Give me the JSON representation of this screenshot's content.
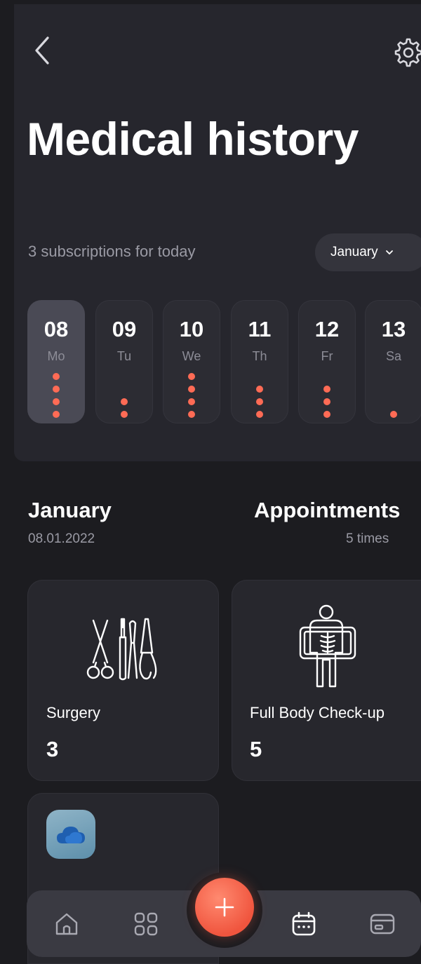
{
  "header": {
    "title": "Medical history",
    "subscriptions_text": "3 subscriptions for today",
    "month_select": "January"
  },
  "days": [
    {
      "num": "08",
      "name": "Mo",
      "appointments": 4,
      "selected": true
    },
    {
      "num": "09",
      "name": "Tu",
      "appointments": 2,
      "selected": false
    },
    {
      "num": "10",
      "name": "We",
      "appointments": 4,
      "selected": false
    },
    {
      "num": "11",
      "name": "Th",
      "appointments": 3,
      "selected": false
    },
    {
      "num": "12",
      "name": "Fr",
      "appointments": 3,
      "selected": false
    },
    {
      "num": "13",
      "name": "Sa",
      "appointments": 1,
      "selected": false
    }
  ],
  "summary": {
    "month": "January",
    "date": "08.01.2022",
    "appointments_title": "Appointments",
    "appointments_count": "5 times"
  },
  "categories": [
    {
      "label": "Surgery",
      "value": "3",
      "icon": "surgical-tools-icon"
    },
    {
      "label": "Full Body Check-up",
      "value": "5",
      "icon": "body-xray-icon"
    },
    {
      "label": "",
      "value": "",
      "icon": "cloud-app-icon"
    }
  ],
  "nav": {
    "items": [
      "home-icon",
      "grid-icon",
      "calendar-icon",
      "wallet-icon"
    ],
    "fab": "plus-icon"
  },
  "colors": {
    "background": "#1c1c20",
    "panel": "#26262d",
    "accent": "#ff6b55"
  }
}
